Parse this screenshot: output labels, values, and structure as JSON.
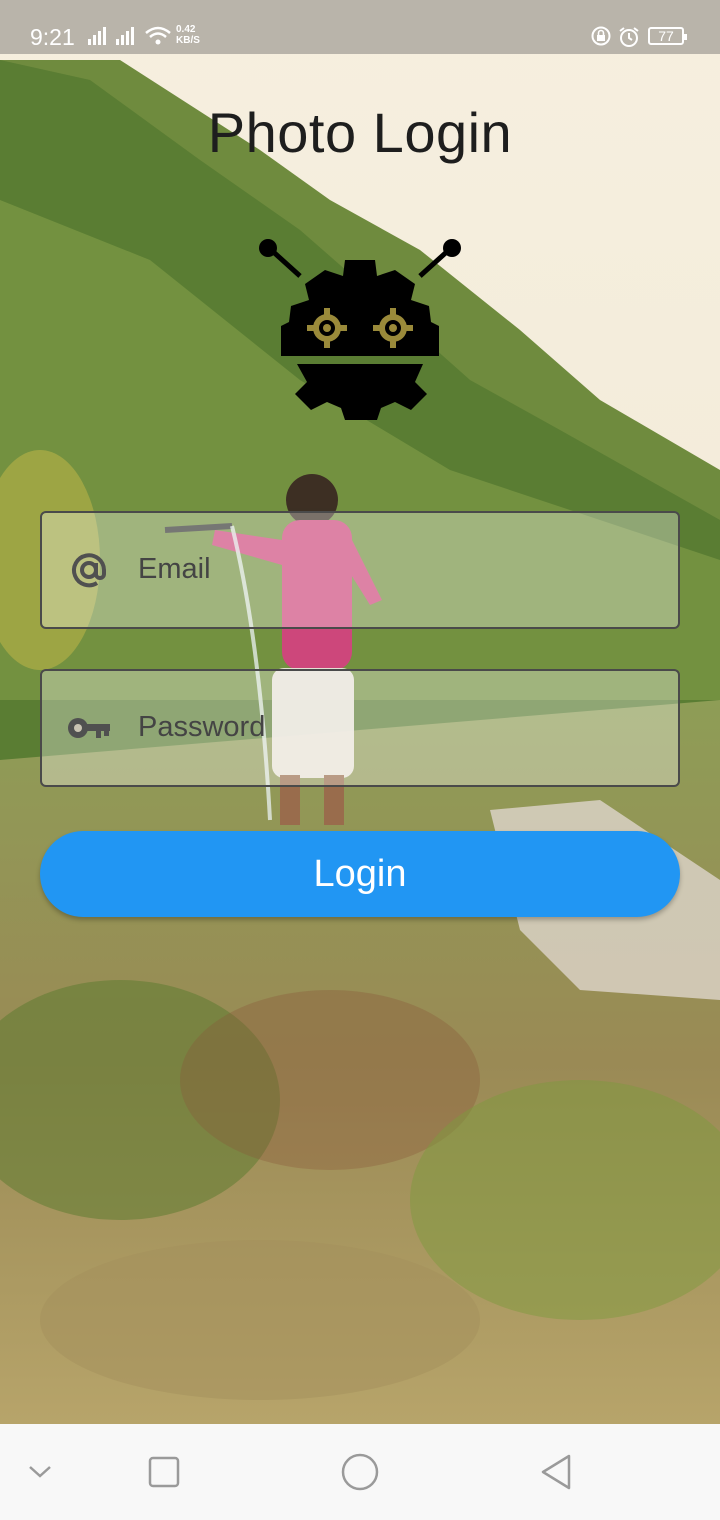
{
  "status_bar": {
    "time": "9:21",
    "network_speed_value": "0.42",
    "network_speed_unit": "KB/S",
    "battery_level": "77"
  },
  "screen": {
    "title": "Photo Login"
  },
  "form": {
    "email_placeholder": "Email",
    "password_placeholder": "Password",
    "login_label": "Login"
  },
  "colors": {
    "accent": "#2196f3",
    "status_bar": "#b9b4aa",
    "nav_bar": "#f8f8f8"
  },
  "icons": {
    "email": "at-sign-icon",
    "password": "key-icon",
    "logo": "robot-gear-icon",
    "nav": [
      "chevron-down-icon",
      "square-recents-icon",
      "circle-home-icon",
      "triangle-back-icon"
    ]
  }
}
